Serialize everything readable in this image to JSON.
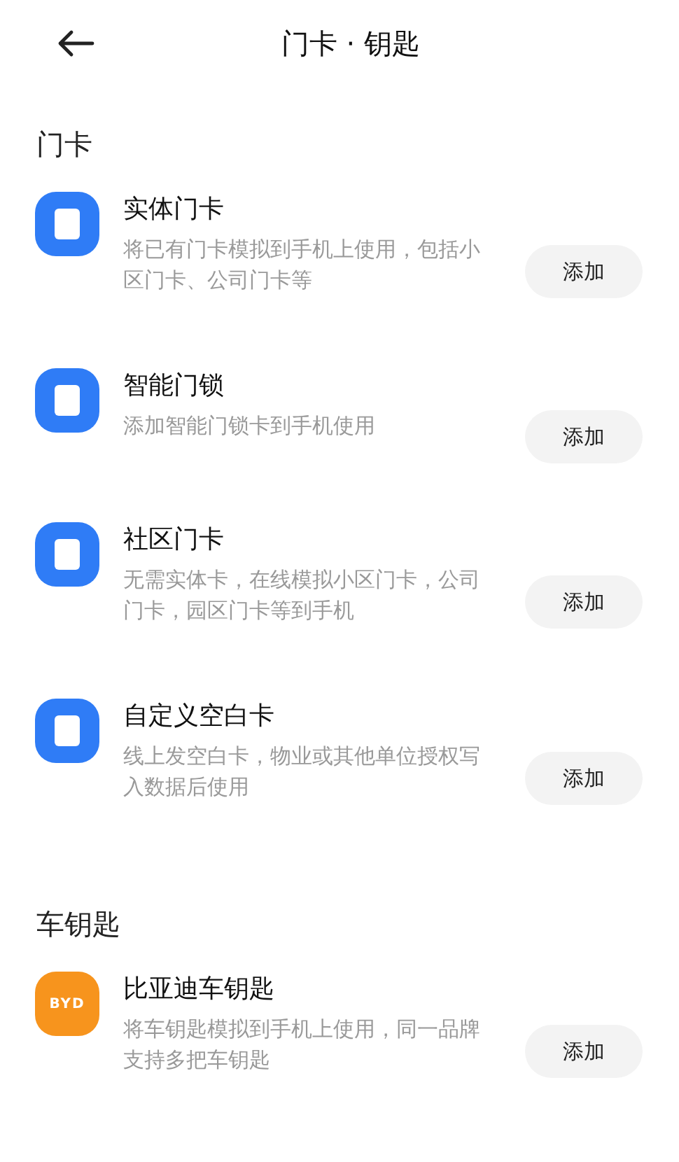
{
  "header": {
    "title": "门卡 · 钥匙"
  },
  "sections": [
    {
      "heading": "门卡",
      "items": [
        {
          "kind": "card",
          "title": "实体门卡",
          "description": "将已有门卡模拟到手机上使用，包括小区门卡、公司门卡等",
          "button": "添加"
        },
        {
          "kind": "card",
          "title": "智能门锁",
          "description": "添加智能门锁卡到手机使用",
          "button": "添加"
        },
        {
          "kind": "card",
          "title": "社区门卡",
          "description": "无需实体卡，在线模拟小区门卡，公司门卡，园区门卡等到手机",
          "button": "添加"
        },
        {
          "kind": "card",
          "title": "自定义空白卡",
          "description": "线上发空白卡，物业或其他单位授权写入数据后使用",
          "button": "添加"
        }
      ]
    },
    {
      "heading": "车钥匙",
      "items": [
        {
          "kind": "brand",
          "logo": "BYD",
          "title": "比亚迪车钥匙",
          "description": "将车钥匙模拟到手机上使用，同一品牌支持多把车钥匙",
          "button": "添加"
        }
      ]
    }
  ]
}
